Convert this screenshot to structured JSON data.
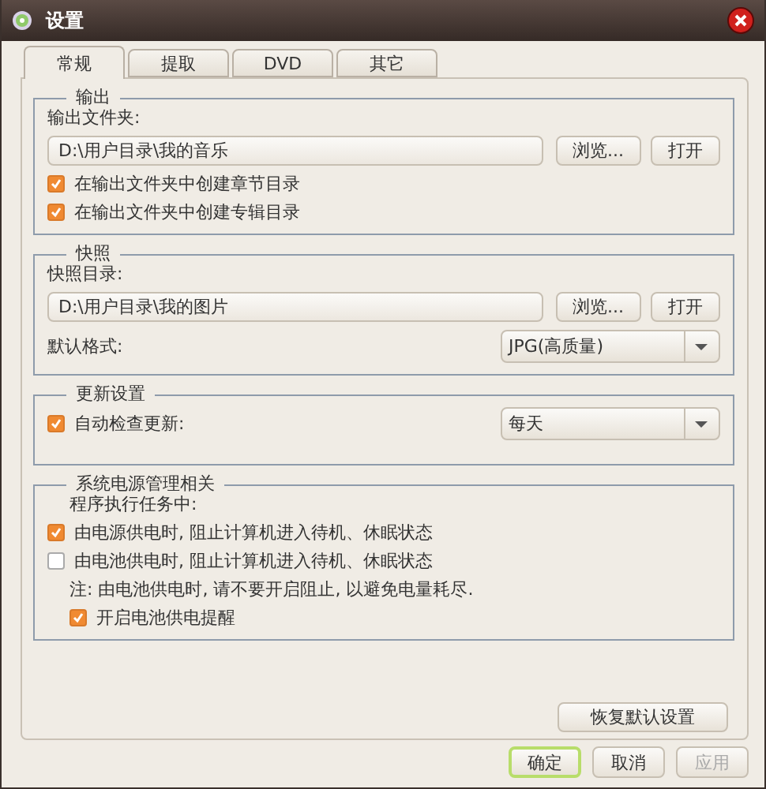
{
  "window": {
    "title": "设置"
  },
  "tabs": [
    {
      "label": "常规",
      "selected": true
    },
    {
      "label": "提取",
      "selected": false
    },
    {
      "label": "DVD",
      "selected": false
    },
    {
      "label": "其它",
      "selected": false
    }
  ],
  "sections": [
    {
      "title": "输出",
      "rows": [
        {
          "kind": "label",
          "text": "输出文件夹:"
        },
        {
          "kind": "path",
          "value": "D:\\用户目录\\我的音乐",
          "buttons": [
            "浏览...",
            "打开"
          ]
        },
        {
          "kind": "checkbox",
          "label": "在输出文件夹中创建章节目录",
          "checked": true
        },
        {
          "kind": "checkbox",
          "label": "在输出文件夹中创建专辑目录",
          "checked": true
        }
      ]
    },
    {
      "title": "快照",
      "rows": [
        {
          "kind": "label",
          "text": "快照目录:"
        },
        {
          "kind": "path",
          "value": "D:\\用户目录\\我的图片",
          "buttons": [
            "浏览...",
            "打开"
          ]
        },
        {
          "kind": "select",
          "label": "默认格式:",
          "value": "JPG(高质量)"
        }
      ]
    },
    {
      "title": "更新设置",
      "rows": [
        {
          "kind": "checkselect",
          "label": "自动检查更新:",
          "checked": true,
          "value": "每天"
        }
      ]
    },
    {
      "title": "系统电源管理相关",
      "rows": [
        {
          "kind": "caption",
          "text": "程序执行任务中:"
        },
        {
          "kind": "checkbox",
          "label": "由电源供电时, 阻止计算机进入待机、休眠状态",
          "checked": true
        },
        {
          "kind": "checkbox",
          "label": "由电池供电时, 阻止计算机进入待机、休眠状态",
          "checked": false
        },
        {
          "kind": "note",
          "text": "注: 由电池供电时, 请不要开启阻止, 以避免电量耗尽.",
          "children": [
            {
              "kind": "checkbox",
              "label": "开启电池供电提醒",
              "checked": true
            }
          ]
        }
      ]
    }
  ],
  "restore_button": "恢复默认设置",
  "buttons": [
    {
      "label": "确定",
      "focused": true,
      "disabled": false
    },
    {
      "label": "取消",
      "focused": false,
      "disabled": false
    },
    {
      "label": "应用",
      "focused": false,
      "disabled": true
    }
  ]
}
